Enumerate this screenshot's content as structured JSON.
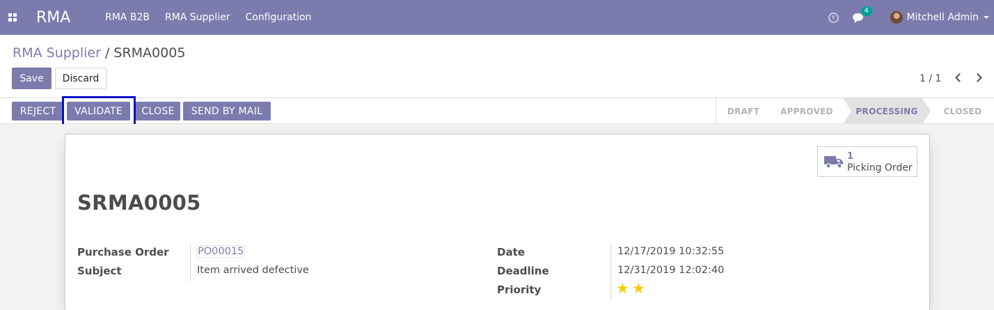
{
  "navbar": {
    "app_name": "RMA",
    "menu": [
      "RMA B2B",
      "RMA Supplier",
      "Configuration"
    ],
    "message_count": "4",
    "user_name": "Mitchell Admin"
  },
  "breadcrumb": {
    "parent": "RMA Supplier",
    "separator": " / ",
    "current": "SRMA0005"
  },
  "buttons": {
    "save": "Save",
    "discard": "Discard"
  },
  "pager": {
    "value": "1 / 1"
  },
  "statusbar": {
    "actions": [
      "REJECT",
      "VALIDATE",
      "CLOSE",
      "SEND BY MAIL"
    ],
    "stages": [
      "DRAFT",
      "APPROVED",
      "PROCESSING",
      "CLOSED"
    ],
    "active_stage": "PROCESSING"
  },
  "smart_button": {
    "value": "1",
    "label": "Picking Order",
    "icon": "truck-icon"
  },
  "record": {
    "name": "SRMA0005",
    "purchase_order_label": "Purchase Order",
    "purchase_order": "PO00015",
    "subject_label": "Subject",
    "subject": "Item arrived defective",
    "date_label": "Date",
    "date": "12/17/2019 10:32:55",
    "deadline_label": "Deadline",
    "deadline": "12/31/2019 12:02:40",
    "priority_label": "Priority",
    "priority_stars": 2
  },
  "colors": {
    "brand": "#7c7bad",
    "highlight": "#0a10c8",
    "star": "#f3cc00"
  }
}
